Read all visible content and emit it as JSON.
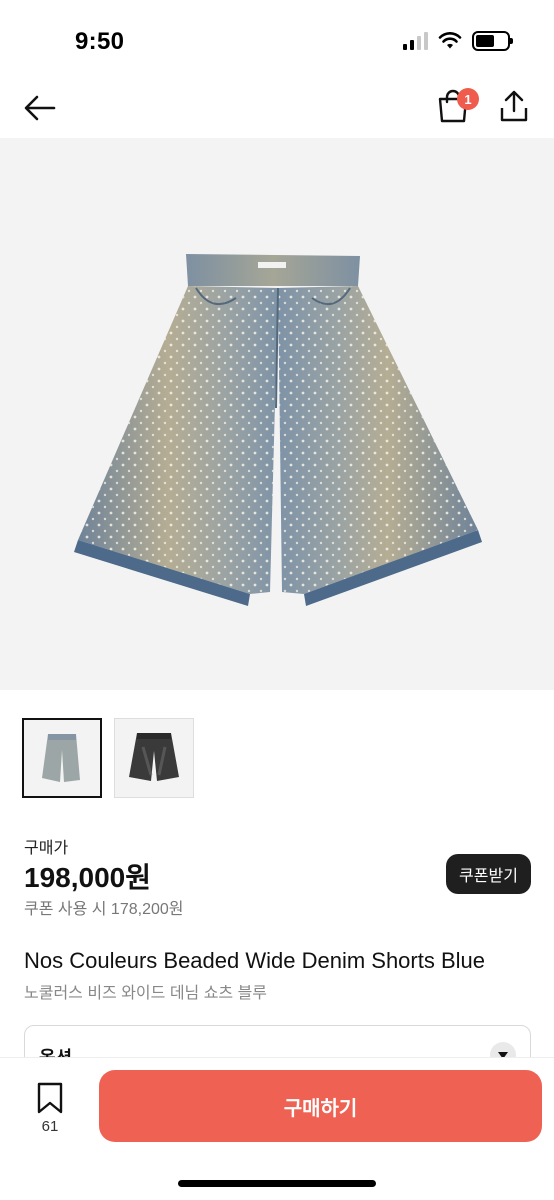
{
  "status_bar": {
    "time": "9:50"
  },
  "nav": {
    "cart_count": "1"
  },
  "thumbnails": [
    {
      "name": "light-blue-denim"
    },
    {
      "name": "black-denim"
    }
  ],
  "pricing": {
    "label": "구매가",
    "price": "198,000원",
    "coupon_price": "쿠폰 사용 시 178,200원",
    "coupon_button": "쿠폰받기"
  },
  "product": {
    "title": "Nos Couleurs Beaded Wide Denim Shorts Blue",
    "subtitle": "노쿨러스 비즈 와이드 데님 쇼츠 블루"
  },
  "option": {
    "label": "옵션"
  },
  "bottom_bar": {
    "bookmark_count": "61",
    "buy_label": "구매하기"
  },
  "colors": {
    "accent": "#ef6253",
    "badge": "#ef5b4c",
    "dark_button": "#1f1f1f"
  }
}
